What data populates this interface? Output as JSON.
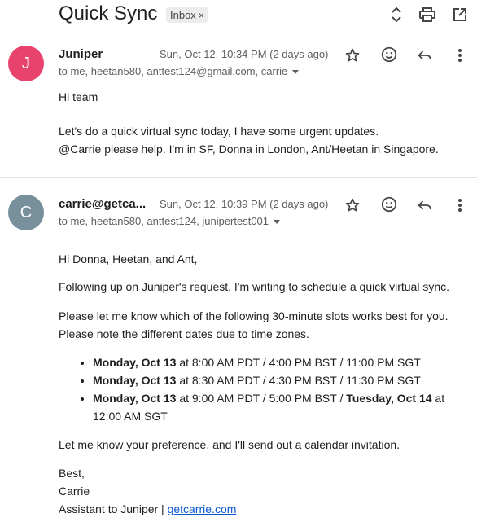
{
  "header": {
    "subject": "Quick Sync",
    "label": "Inbox",
    "label_close": "×",
    "icons": [
      "expand-collapse-icon",
      "print-icon",
      "open-new-window-icon"
    ]
  },
  "messages": [
    {
      "avatar_letter": "J",
      "avatar_color": "#e8436d",
      "sender": "Juniper",
      "date": "Sun, Oct 12, 10:34 PM (2 days ago)",
      "to": "to me, heetan580, anttest124@gmail.com, carrie",
      "body": [
        "Hi team",
        "Let's do a quick virtual sync today, I have some urgent updates.",
        "@Carrie please help. I'm in SF, Donna in London, Ant/Heetan in Singapore."
      ]
    },
    {
      "avatar_letter": "C",
      "avatar_color": "#78909c",
      "sender": "carrie@getca...",
      "date": "Sun, Oct 12, 10:39 PM (2 days ago)",
      "to": "to me, heetan580, anttest124, junipertest001",
      "greeting": "Hi Donna, Heetan, and Ant,",
      "p1": "Following up on Juniper's request, I'm writing to schedule a quick virtual sync.",
      "p2a": "Please let me know which of the following 30-minute slots works best for you.",
      "p2b": "Please note the different dates due to time zones.",
      "slots": [
        {
          "day": "Monday, Oct 13",
          "text": " at 8:00 AM PDT / 4:00 PM BST / 11:00 PM SGT"
        },
        {
          "day": "Monday, Oct 13",
          "text": " at 8:30 AM PDT / 4:30 PM BST / 11:30 PM SGT"
        },
        {
          "day": "Monday, Oct 13",
          "text": " at 9:00 AM PDT / 5:00 PM BST / ",
          "day2": "Tuesday, Oct 14",
          "text2": " at 12:00 AM SGT"
        }
      ],
      "closing": "Let me know your preference, and I'll send out a calendar invitation.",
      "signoff": "Best,",
      "signature_name": "Carrie",
      "signature_role": "Assistant to Juniper | ",
      "signature_link": "getcarrie.com"
    }
  ],
  "colors": {
    "link": "#0b57d0",
    "text": "#1f1f1f",
    "muted": "#5e5e5e"
  }
}
